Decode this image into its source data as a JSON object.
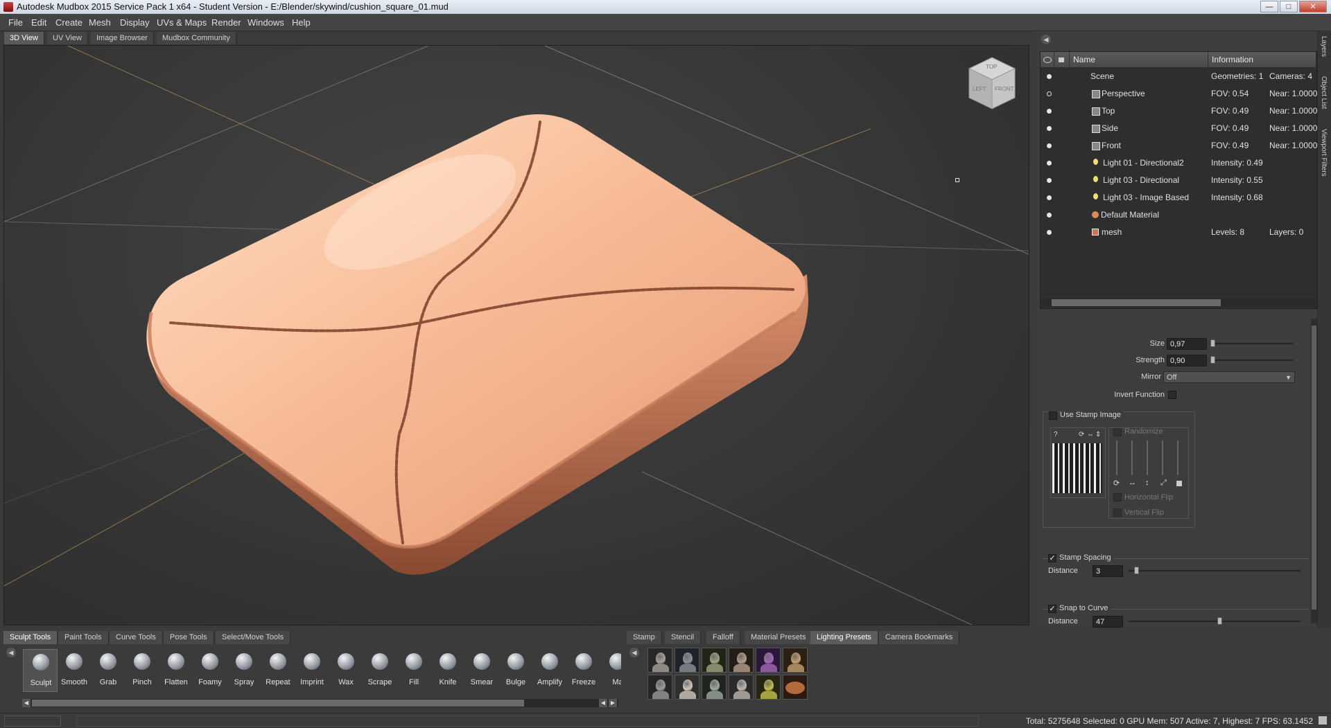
{
  "window": {
    "title": "Autodesk Mudbox 2015 Service Pack 1 x64 - Student Version - E:/Blender/skywind/cushion_square_01.mud",
    "minimize": "—",
    "maximize": "□",
    "close": "✕"
  },
  "menu": [
    "File",
    "Edit",
    "Create",
    "Mesh",
    "Display",
    "UVs & Maps",
    "Render",
    "Windows",
    "Help"
  ],
  "view_tabs": [
    "3D View",
    "UV View",
    "Image Browser",
    "Mudbox Community"
  ],
  "view_cube": {
    "top": "TOP",
    "left": "LEFT",
    "front": "FRONT"
  },
  "object_list": {
    "columns": {
      "name": "Name",
      "information": "Information"
    },
    "rows": [
      {
        "name": "Scene",
        "info1": "Geometries: 1",
        "info2": "Cameras: 4",
        "icon": "scene-icon",
        "visible": true
      },
      {
        "name": "Perspective",
        "info1": "FOV: 0.54",
        "info2": "Near: 1.0000",
        "icon": "camera-icon",
        "visible": false
      },
      {
        "name": "Top",
        "info1": "FOV: 0.49",
        "info2": "Near: 1.0000",
        "icon": "camera-icon",
        "visible": true
      },
      {
        "name": "Side",
        "info1": "FOV: 0.49",
        "info2": "Near: 1.0000",
        "icon": "camera-icon",
        "visible": true
      },
      {
        "name": "Front",
        "info1": "FOV: 0.49",
        "info2": "Near: 1.0000",
        "icon": "camera-icon",
        "visible": true
      },
      {
        "name": "Light 01 - Directional2",
        "info1": "Intensity: 0.49",
        "info2": "",
        "icon": "light-icon",
        "visible": true
      },
      {
        "name": "Light 03 - Directional",
        "info1": "Intensity: 0.55",
        "info2": "",
        "icon": "light-icon",
        "visible": true
      },
      {
        "name": "Light 03 - Image Based",
        "info1": "Intensity: 0.68",
        "info2": "",
        "icon": "light-icon",
        "visible": true
      },
      {
        "name": "Default Material",
        "info1": "",
        "info2": "",
        "icon": "material-icon",
        "visible": true
      },
      {
        "name": "mesh",
        "info1": "Levels: 8",
        "info2": "Layers: 0",
        "icon": "mesh-icon",
        "visible": true
      }
    ]
  },
  "side_tabs": [
    "Layers",
    "Object List",
    "Viewport Filters"
  ],
  "properties": {
    "size_label": "Size",
    "size_value": "0,97",
    "size_slider": 0.0,
    "strength_label": "Strength",
    "strength_value": "0,90",
    "strength_slider": 0.0,
    "mirror_label": "Mirror",
    "mirror_value": "Off",
    "invert_label": "Invert Function",
    "use_stamp_label": "Use Stamp Image",
    "randomize_label": "Randomize",
    "horizontal_flip_label": "Horizontal Flip",
    "vertical_flip_label": "Vertical Flip",
    "stamp_spacing_label": "Stamp Spacing",
    "spacing_distance_label": "Distance",
    "spacing_distance_value": "3",
    "snap_to_curve_label": "Snap to Curve",
    "snap_distance_label": "Distance",
    "snap_distance_value": "47"
  },
  "tool_tabs": [
    "Sculpt Tools",
    "Paint Tools",
    "Curve Tools",
    "Pose Tools",
    "Select/Move Tools"
  ],
  "tools": [
    "Sculpt",
    "Smooth",
    "Grab",
    "Pinch",
    "Flatten",
    "Foamy",
    "Spray",
    "Repeat",
    "Imprint",
    "Wax",
    "Scrape",
    "Fill",
    "Knife",
    "Smear",
    "Bulge",
    "Amplify",
    "Freeze",
    "Ma"
  ],
  "tray_tabs": [
    "Stamp",
    "Stencil",
    "Falloff",
    "Material Presets",
    "Lighting Presets",
    "Camera Bookmarks"
  ],
  "lighting_presets": [
    {
      "head": "#a7a29b",
      "bg": "#272727"
    },
    {
      "head": "#8c929c",
      "bg": "#1f2226"
    },
    {
      "head": "#9fa486",
      "bg": "#222417"
    },
    {
      "head": "#b49f8c",
      "bg": "#231d18"
    },
    {
      "head": "#a468b8",
      "bg": "#2b1838"
    },
    {
      "head": "#c8a070",
      "bg": "#2c2014"
    },
    {
      "head": "#9a9a9a",
      "bg": "#262626"
    },
    {
      "head": "#d0c8bd",
      "bg": "#303030"
    },
    {
      "head": "#a0a8a0",
      "bg": "#1f241f"
    },
    {
      "head": "#bdb7b1",
      "bg": "#2a2a2a"
    },
    {
      "head": "#c5c04c",
      "bg": "#262412"
    },
    {
      "head": "#b56a3c",
      "bg": "#2a1a10"
    }
  ],
  "status": "Total: 5275648  Selected: 0 GPU Mem: 507  Active: 7, Highest: 7  FPS: 63.1452",
  "colors": {
    "cushion": "#f2b08a",
    "accent": "#e8a060"
  }
}
